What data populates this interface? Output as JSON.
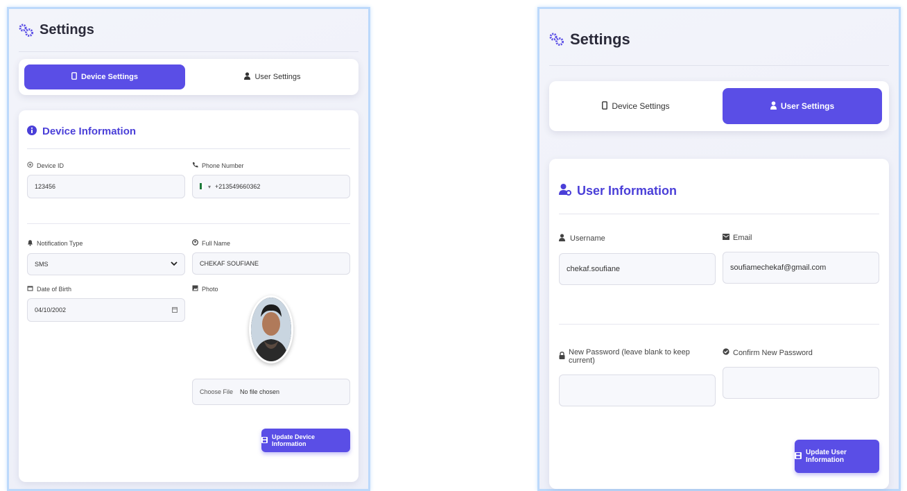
{
  "left": {
    "header": {
      "title": "Settings"
    },
    "tabs": [
      {
        "label": "Device Settings",
        "active": true
      },
      {
        "label": "User Settings",
        "active": false
      }
    ],
    "section_title": "Device Information",
    "fields": {
      "device_id": {
        "label": "Device ID",
        "value": "123456"
      },
      "phone": {
        "label": "Phone Number",
        "value": "+213549660362"
      },
      "notification": {
        "label": "Notification Type",
        "value": "SMS"
      },
      "full_name": {
        "label": "Full Name",
        "value": "CHEKAF SOUFIANE"
      },
      "dob": {
        "label": "Date of Birth",
        "value": "04/10/2002"
      },
      "photo": {
        "label": "Photo"
      },
      "file": {
        "button": "Choose File",
        "status": "No file chosen"
      }
    },
    "submit_label": "Update Device Information"
  },
  "right": {
    "header": {
      "title": "Settings"
    },
    "tabs": [
      {
        "label": "Device Settings",
        "active": false
      },
      {
        "label": "User Settings",
        "active": true
      }
    ],
    "section_title": "User Information",
    "fields": {
      "username": {
        "label": "Username",
        "value": "chekaf.soufiane"
      },
      "email": {
        "label": "Email",
        "value": "soufiamechekaf@gmail.com"
      },
      "new_password": {
        "label": "New Password (leave blank to keep current)",
        "value": ""
      },
      "confirm_password": {
        "label": "Confirm New Password",
        "value": ""
      }
    },
    "submit_label": "Update User Information"
  },
  "colors": {
    "accent": "#5a4ee6",
    "panel_border": "#bcd9fb"
  }
}
